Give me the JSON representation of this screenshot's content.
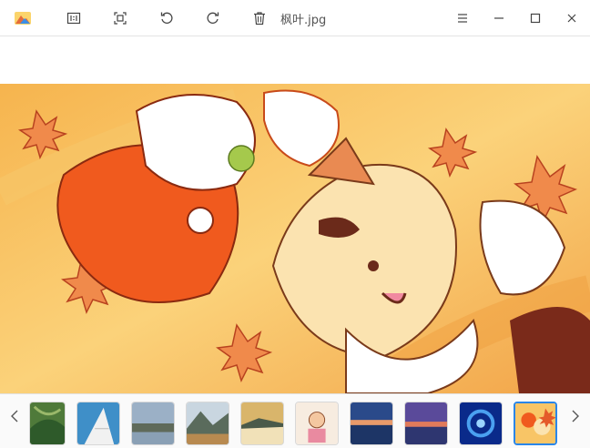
{
  "window": {
    "title": "枫叶.jpg"
  },
  "toolbar": {
    "items": [
      "app-logo",
      "actual-size",
      "fit-window",
      "rotate-left",
      "rotate-right",
      "delete"
    ]
  },
  "window_controls": [
    "menu",
    "minimize",
    "maximize",
    "close"
  ],
  "colors": {
    "accent": "#2a86e8",
    "bg": "#ffffff",
    "icon": "#444444"
  },
  "filmstrip": {
    "thumbnails": [
      "landscape-aerial",
      "white-building-blue-sky",
      "lakeside-town",
      "mountain-village",
      "sea-of-clouds",
      "cartoon-character-sketch",
      "sunset-coast-blue",
      "purple-dusk-lake",
      "blue-swirl-abstract",
      "autumn-cartoon-cats"
    ],
    "active_index": 9
  }
}
